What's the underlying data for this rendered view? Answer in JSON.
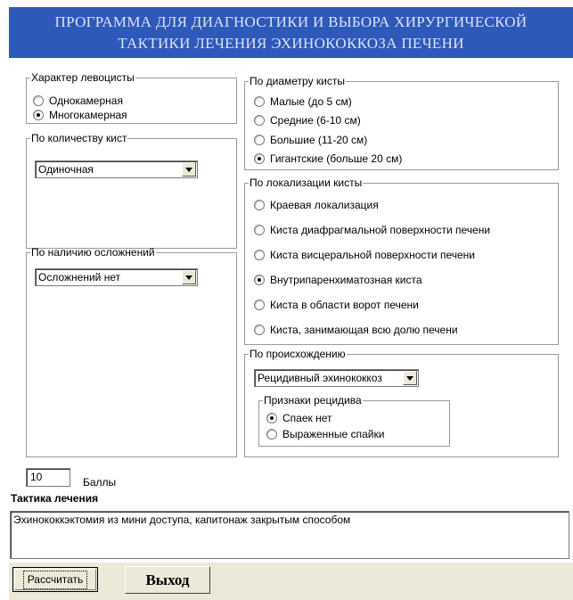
{
  "window": {
    "title_line1": "ПРОГРАММА ДЛЯ ДИАГНОСТИКИ И ВЫБОРА ХИРУРГИЧЕСКОЙ",
    "title_line2": "ТАКТИКИ ЛЕЧЕНИЯ ЭХИНОКОККОЗА ПЕЧЕНИ",
    "title_color": "#2e59b9",
    "frame_color": "#ece9d8"
  },
  "groups": {
    "character": {
      "legend": "Характер левоцисты",
      "options": [
        {
          "label": "Однокамерная",
          "checked": false
        },
        {
          "label": "Многокамерная",
          "checked": true
        }
      ]
    },
    "count": {
      "legend": "По количеству кист",
      "selected": "Одиночная"
    },
    "complications": {
      "legend": "По наличию осложнений",
      "selected": "Осложнений нет"
    },
    "diameter": {
      "legend": "По диаметру кисты",
      "options": [
        {
          "label": "Малые (до 5 см)",
          "checked": false
        },
        {
          "label": "Средние (6-10 см)",
          "checked": false
        },
        {
          "label": "Большие (11-20 см)",
          "checked": false
        },
        {
          "label": "Гигантские (больше 20 см)",
          "checked": true
        }
      ]
    },
    "localization": {
      "legend": "По локализации кисты",
      "options": [
        {
          "label": "Краевая локализация",
          "checked": false
        },
        {
          "label": "Киста диафрагмальной поверхности печени",
          "checked": false
        },
        {
          "label": "Киста висцеральной поверхности печени",
          "checked": false
        },
        {
          "label": "Внутрипаренхиматозная киста",
          "checked": true
        },
        {
          "label": "Киста в области ворот печени",
          "checked": false
        },
        {
          "label": "Киста, занимающая всю долю печени",
          "checked": false
        }
      ]
    },
    "origin": {
      "legend": "По происхождению",
      "selected": "Рецидивный эхинококкоз"
    },
    "relapse": {
      "legend": "Признаки рецидива",
      "options": [
        {
          "label": "Спаек нет",
          "checked": true
        },
        {
          "label": "Выраженные спайки",
          "checked": false
        }
      ]
    }
  },
  "score": {
    "value": "10",
    "label": "Баллы"
  },
  "tactics": {
    "label": "Тактика лечения",
    "text": "Эхинококкэктомия из мини доступа, капитонаж закрытым способом"
  },
  "buttons": {
    "calculate": "Рассчитать",
    "exit": "Выход"
  },
  "icons": {
    "dropdown": "chevron-down-icon"
  }
}
